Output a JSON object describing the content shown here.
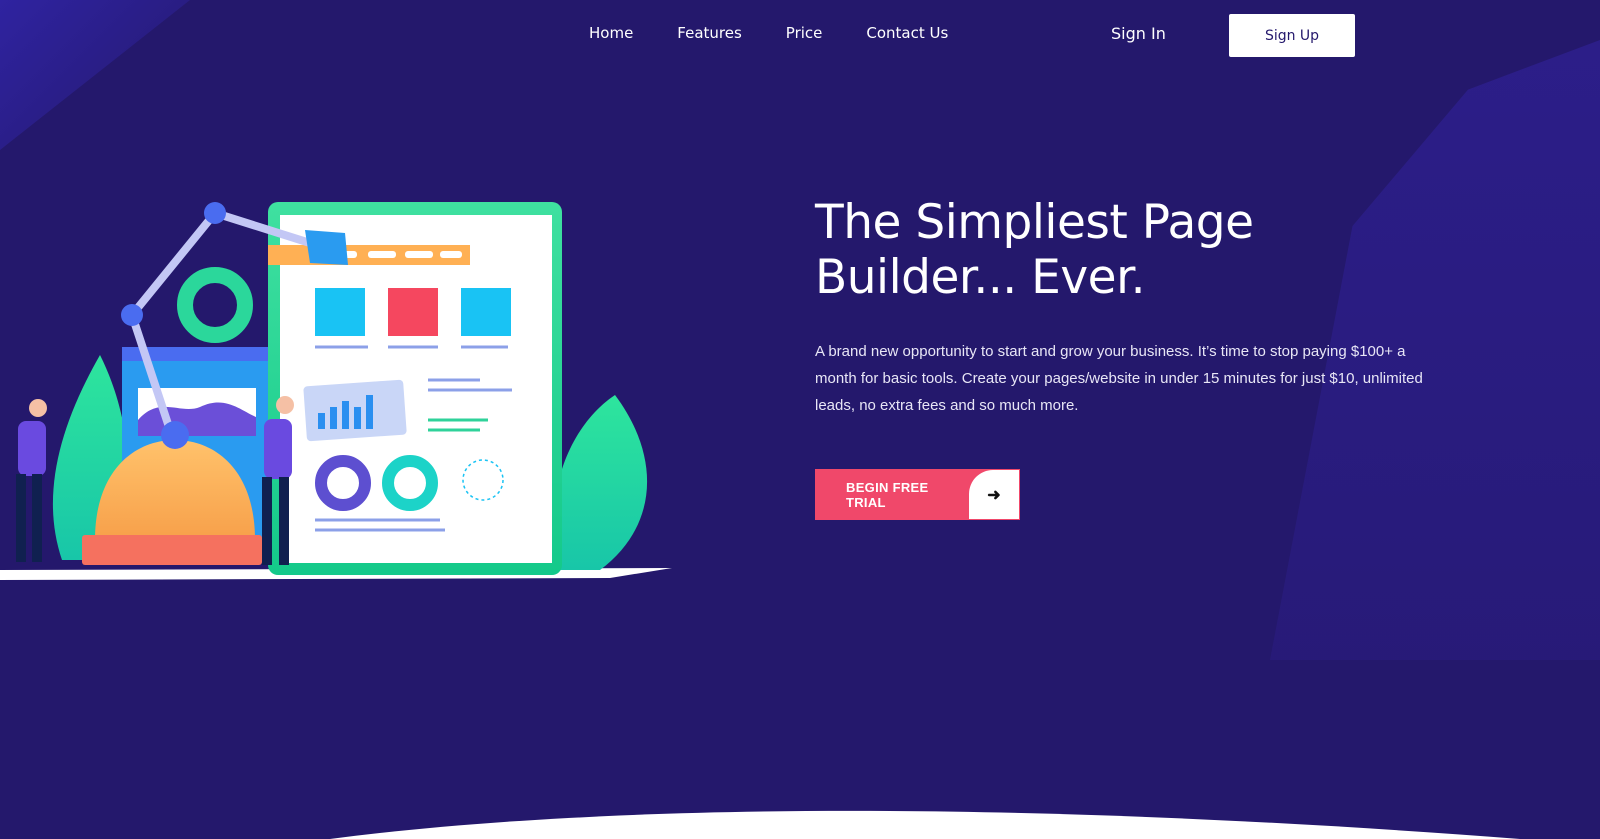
{
  "nav": {
    "items": [
      {
        "label": "Home"
      },
      {
        "label": "Features"
      },
      {
        "label": "Price"
      },
      {
        "label": "Contact Us"
      }
    ],
    "sign_in": "Sign In",
    "sign_up": "Sign Up"
  },
  "hero": {
    "title": "The Simpliest Page Builder... Ever.",
    "description": "A brand new opportunity to start and grow your business. It’s time to stop paying $100+ a month for basic tools. Create your pages/website in under 15 minutes for just $10, unlimited leads, no extra fees and so much more.",
    "cta_label": "BEGIN FREE TRIAL",
    "cta_icon": "arrow-right-icon"
  },
  "colors": {
    "background": "#24186c",
    "accent": "#f0486a",
    "white": "#ffffff"
  }
}
